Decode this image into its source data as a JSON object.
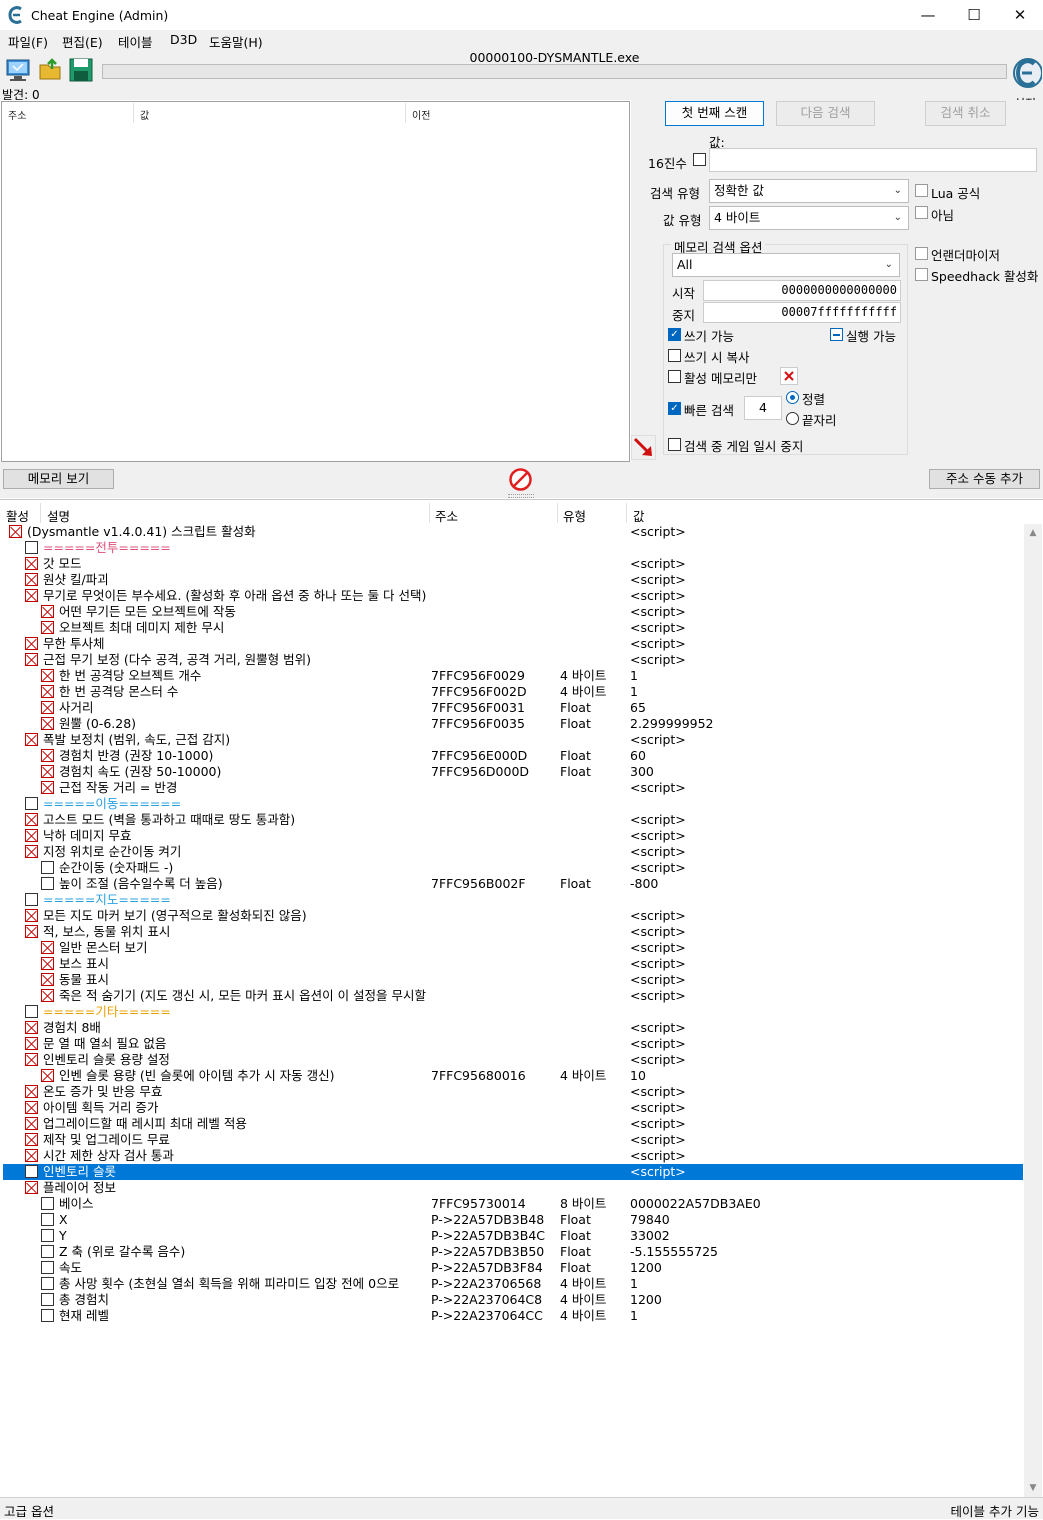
{
  "window": {
    "title": "Cheat Engine (Admin)",
    "minimize": "—",
    "maximize": "☐",
    "close": "✕"
  },
  "menu": [
    "파일(F)",
    "편집(E)",
    "테이블",
    "D3D",
    "도움말(H)"
  ],
  "toolbar": {
    "process_name": "00000100-DYSMANTLE.exe",
    "found_label": "발견: 0",
    "settings_label": "설정"
  },
  "upper_list": {
    "headers": [
      "주소",
      "값",
      "이전"
    ]
  },
  "scan": {
    "first_scan": "첫 번째 스캔",
    "next_scan": "다음 검색",
    "undo_scan": "검색 취소",
    "value_label": "값:",
    "hex_label": "16진수",
    "value_input": "",
    "scan_type_label": "검색 유형",
    "scan_type_value": "정확한 값",
    "value_type_label": "값 유형",
    "value_type_value": "4 바이트",
    "lua_formula": "Lua 공식",
    "not_label": "아님",
    "mem_options_title": "메모리 검색 옵션",
    "mem_region": "All",
    "start_label": "시작",
    "start_value": "0000000000000000",
    "stop_label": "중지",
    "stop_value": "00007fffffffffff",
    "writable": "쓰기 가능",
    "executable": "실행 가능",
    "copy_on_write": "쓰기 시 복사",
    "active_memory": "활성 메모리만",
    "fast_scan": "빠른 검색",
    "fast_scan_value": "4",
    "aligned": "정렬",
    "last_digits": "끝자리",
    "pause_game": "검색 중 게임 일시 중지",
    "unrandomizer": "언랜더마이저",
    "speedhack": "Speedhack 활성화"
  },
  "buttons": {
    "memory_view": "메모리 보기",
    "add_address": "주소 수동 추가"
  },
  "table": {
    "headers": {
      "active": "활성",
      "desc": "설명",
      "address": "주소",
      "type": "유형",
      "value": "값"
    },
    "rows": [
      {
        "indent": 0,
        "checked": true,
        "desc": "(Dysmantle v1.4.0.41) 스크립트 활성화",
        "addr": "",
        "type": "",
        "value": "<script>",
        "color": ""
      },
      {
        "indent": 1,
        "checked": false,
        "desc": "=====전투=====",
        "addr": "",
        "type": "",
        "value": "",
        "color": "red"
      },
      {
        "indent": 1,
        "checked": true,
        "desc": "갓 모드",
        "addr": "",
        "type": "",
        "value": "<script>",
        "color": ""
      },
      {
        "indent": 1,
        "checked": true,
        "desc": "원샷 킬/파괴",
        "addr": "",
        "type": "",
        "value": "<script>",
        "color": ""
      },
      {
        "indent": 1,
        "checked": true,
        "desc": "무기로 무엇이든 부수세요. (활성화 후 아래 옵션 중 하나 또는 둘 다 선택)",
        "addr": "",
        "type": "",
        "value": "<script>",
        "color": ""
      },
      {
        "indent": 2,
        "checked": true,
        "desc": "어떤 무기든 모든 오브젝트에 작동",
        "addr": "",
        "type": "",
        "value": "<script>",
        "color": ""
      },
      {
        "indent": 2,
        "checked": true,
        "desc": "오브젝트 최대 데미지 제한 무시",
        "addr": "",
        "type": "",
        "value": "<script>",
        "color": ""
      },
      {
        "indent": 1,
        "checked": true,
        "desc": "무한 투사체",
        "addr": "",
        "type": "",
        "value": "<script>",
        "color": ""
      },
      {
        "indent": 1,
        "checked": true,
        "desc": "근접 무기 보정 (다수 공격, 공격 거리, 원뿔형 범위)",
        "addr": "",
        "type": "",
        "value": "<script>",
        "color": ""
      },
      {
        "indent": 2,
        "checked": true,
        "desc": "한 번 공격당 오브젝트 개수",
        "addr": "7FFC956F0029",
        "type": "4 바이트",
        "value": "1",
        "color": ""
      },
      {
        "indent": 2,
        "checked": true,
        "desc": "한 번 공격당 몬스터 수",
        "addr": "7FFC956F002D",
        "type": "4 바이트",
        "value": "1",
        "color": ""
      },
      {
        "indent": 2,
        "checked": true,
        "desc": "사거리",
        "addr": "7FFC956F0031",
        "type": "Float",
        "value": "65",
        "color": ""
      },
      {
        "indent": 2,
        "checked": true,
        "desc": "원뿔 (0-6.28)",
        "addr": "7FFC956F0035",
        "type": "Float",
        "value": "2.299999952",
        "color": ""
      },
      {
        "indent": 1,
        "checked": true,
        "desc": "폭발 보정치 (범위, 속도, 근접 감지)",
        "addr": "",
        "type": "",
        "value": "<script>",
        "color": ""
      },
      {
        "indent": 2,
        "checked": true,
        "desc": "경험치 반경 (권장 10-1000)",
        "addr": "7FFC956E000D",
        "type": "Float",
        "value": "60",
        "color": ""
      },
      {
        "indent": 2,
        "checked": true,
        "desc": "경험치 속도 (권장 50-10000)",
        "addr": "7FFC956D000D",
        "type": "Float",
        "value": "300",
        "color": ""
      },
      {
        "indent": 2,
        "checked": true,
        "desc": "근접 작동 거리 = 반경",
        "addr": "",
        "type": "",
        "value": "<script>",
        "color": ""
      },
      {
        "indent": 1,
        "checked": false,
        "desc": "=====이동======",
        "addr": "",
        "type": "",
        "value": "",
        "color": "blue"
      },
      {
        "indent": 1,
        "checked": true,
        "desc": "고스트 모드 (벽을 통과하고 때때로 땅도 통과함)",
        "addr": "",
        "type": "",
        "value": "<script>",
        "color": ""
      },
      {
        "indent": 1,
        "checked": true,
        "desc": "낙하 데미지 무효",
        "addr": "",
        "type": "",
        "value": "<script>",
        "color": ""
      },
      {
        "indent": 1,
        "checked": true,
        "desc": "지정 위치로 순간이동 켜기",
        "addr": "",
        "type": "",
        "value": "<script>",
        "color": ""
      },
      {
        "indent": 2,
        "checked": false,
        "desc": "순간이동 (숫자패드 -)",
        "addr": "",
        "type": "",
        "value": "<script>",
        "color": ""
      },
      {
        "indent": 2,
        "checked": false,
        "desc": "높이 조절 (음수일수록 더 높음)",
        "addr": "7FFC956B002F",
        "type": "Float",
        "value": "-800",
        "color": ""
      },
      {
        "indent": 1,
        "checked": false,
        "desc": "=====지도=====",
        "addr": "",
        "type": "",
        "value": "",
        "color": "blue"
      },
      {
        "indent": 1,
        "checked": true,
        "desc": "모든 지도 마커 보기 (영구적으로 활성화되진 않음)",
        "addr": "",
        "type": "",
        "value": "<script>",
        "color": ""
      },
      {
        "indent": 1,
        "checked": true,
        "desc": "적, 보스, 동물 위치 표시",
        "addr": "",
        "type": "",
        "value": "<script>",
        "color": ""
      },
      {
        "indent": 2,
        "checked": true,
        "desc": "일반 몬스터 보기",
        "addr": "",
        "type": "",
        "value": "<script>",
        "color": ""
      },
      {
        "indent": 2,
        "checked": true,
        "desc": "보스 표시",
        "addr": "",
        "type": "",
        "value": "<script>",
        "color": ""
      },
      {
        "indent": 2,
        "checked": true,
        "desc": "동물 표시",
        "addr": "",
        "type": "",
        "value": "<script>",
        "color": ""
      },
      {
        "indent": 2,
        "checked": true,
        "desc": "죽은 적 숨기기 (지도 갱신 시, 모든 마커 표시 옵션이 이 설정을 무시할 수 있음)",
        "addr": "",
        "type": "",
        "value": "<script>",
        "color": ""
      },
      {
        "indent": 1,
        "checked": false,
        "desc": "=====기타=====",
        "addr": "",
        "type": "",
        "value": "",
        "color": "orange"
      },
      {
        "indent": 1,
        "checked": true,
        "desc": "경험치 8배",
        "addr": "",
        "type": "",
        "value": "<script>",
        "color": ""
      },
      {
        "indent": 1,
        "checked": true,
        "desc": "문 열 때 열쇠 필요 없음",
        "addr": "",
        "type": "",
        "value": "<script>",
        "color": ""
      },
      {
        "indent": 1,
        "checked": true,
        "desc": "인벤토리 슬롯 용량 설정",
        "addr": "",
        "type": "",
        "value": "<script>",
        "color": ""
      },
      {
        "indent": 2,
        "checked": true,
        "desc": "인벤 슬롯 용량 (빈 슬롯에 아이템 추가 시 자동 갱신)",
        "addr": "7FFC95680016",
        "type": "4 바이트",
        "value": "10",
        "color": ""
      },
      {
        "indent": 1,
        "checked": true,
        "desc": "온도 증가 및 반응 무효",
        "addr": "",
        "type": "",
        "value": "<script>",
        "color": ""
      },
      {
        "indent": 1,
        "checked": true,
        "desc": "아이템 획득 거리 증가",
        "addr": "",
        "type": "",
        "value": "<script>",
        "color": ""
      },
      {
        "indent": 1,
        "checked": true,
        "desc": "업그레이드할 때 레시피 최대 레벨 적용",
        "addr": "",
        "type": "",
        "value": "<script>",
        "color": ""
      },
      {
        "indent": 1,
        "checked": true,
        "desc": "제작 및 업그레이드 무료",
        "addr": "",
        "type": "",
        "value": "<script>",
        "color": ""
      },
      {
        "indent": 1,
        "checked": true,
        "desc": "시간 제한 상자 검사 통과",
        "addr": "",
        "type": "",
        "value": "<script>",
        "color": ""
      },
      {
        "indent": 1,
        "checked": false,
        "desc": "인벤토리 슬롯",
        "addr": "",
        "type": "",
        "value": "<script>",
        "color": "",
        "selected": true
      },
      {
        "indent": 1,
        "checked": true,
        "desc": "플레이어 정보",
        "addr": "",
        "type": "",
        "value": "",
        "color": ""
      },
      {
        "indent": 2,
        "checked": false,
        "desc": "베이스",
        "addr": "7FFC95730014",
        "type": "8 바이트",
        "value": "0000022A57DB3AE0",
        "color": ""
      },
      {
        "indent": 2,
        "checked": false,
        "desc": "X",
        "addr": "P->22A57DB3B48",
        "type": "Float",
        "value": "79840",
        "color": ""
      },
      {
        "indent": 2,
        "checked": false,
        "desc": "Y",
        "addr": "P->22A57DB3B4C",
        "type": "Float",
        "value": "33002",
        "color": ""
      },
      {
        "indent": 2,
        "checked": false,
        "desc": "Z 축 (위로 갈수록 음수)",
        "addr": "P->22A57DB3B50",
        "type": "Float",
        "value": "-5.155555725",
        "color": ""
      },
      {
        "indent": 2,
        "checked": false,
        "desc": "속도",
        "addr": "P->22A57DB3F84",
        "type": "Float",
        "value": "1200",
        "color": ""
      },
      {
        "indent": 2,
        "checked": false,
        "desc": "총 사망 횟수 (초현실 열쇠 획득을 위해 피라미드 입장 전에 0으로",
        "addr": "P->22A23706568",
        "type": "4 바이트",
        "value": "1",
        "color": ""
      },
      {
        "indent": 2,
        "checked": false,
        "desc": "총 경험치",
        "addr": "P->22A237064C8",
        "type": "4 바이트",
        "value": "1200",
        "color": ""
      },
      {
        "indent": 2,
        "checked": false,
        "desc": "현재 레벨",
        "addr": "P->22A237064CC",
        "type": "4 바이트",
        "value": "1",
        "color": ""
      }
    ]
  },
  "status": {
    "left": "고급 옵션",
    "right": "테이블 추가 기능"
  }
}
